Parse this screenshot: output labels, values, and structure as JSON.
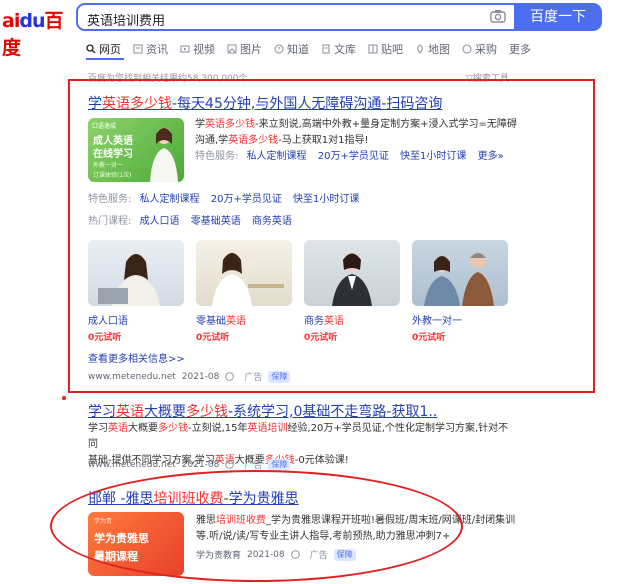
{
  "header": {
    "logo_prefix": "ai",
    "logo_du": "du",
    "logo_suffix": "百度",
    "search_value": "英语培训费用",
    "search_button": "百度一下"
  },
  "tabs": [
    {
      "label": "网页",
      "icon": "search-icon"
    },
    {
      "label": "资讯",
      "icon": "news-icon"
    },
    {
      "label": "视频",
      "icon": "video-icon"
    },
    {
      "label": "图片",
      "icon": "image-icon"
    },
    {
      "label": "知道",
      "icon": "question-icon"
    },
    {
      "label": "文库",
      "icon": "document-icon"
    },
    {
      "label": "贴吧",
      "icon": "forum-icon"
    },
    {
      "label": "地图",
      "icon": "map-icon"
    },
    {
      "label": "采购",
      "icon": "purchase-icon"
    },
    {
      "label": "更多",
      "icon": ""
    }
  ],
  "result_count": "百度为您找到相关结果约58,300,000个",
  "tools": "▽搜索工具",
  "ad1": {
    "title_pre": "学",
    "title_hl": "英语多少钱",
    "title_post": "-每天45分钟,与外国人无障碍沟通-扫码咨询",
    "thumb_tag": "口语速成",
    "thumb_line1": "成人英语",
    "thumb_line2": "在线学习",
    "thumb_line3": "外教一对一",
    "thumb_line4": "订课体验(1次)",
    "abs1_pre": "学",
    "abs1_hl": "英语多少钱",
    "abs1_post": "-来立刻说,高端中外教+量身定制方案+浸入式学习=无障碍",
    "abs2_pre": "沟通,学",
    "abs2_hl": "英语多少钱",
    "abs2_post": "-马上获取1对1指导!",
    "feature_label": "特色服务:",
    "feature_items": [
      "私人定制课程",
      "20万+学员见证",
      "快至1小时订课",
      "更多»"
    ],
    "feature2_label": "特色服务:",
    "feature2_items": [
      "私人定制课程",
      "20万+学员见证",
      "快至1小时订课"
    ],
    "hot_label": "热门课程:",
    "hot_items": [
      "成人口语",
      "零基础英语",
      "商务英语"
    ],
    "cards": [
      {
        "cap": "成人口语",
        "cap_hl": "",
        "free": "0元试听"
      },
      {
        "cap": "零基础",
        "cap_hl": "英语",
        "free": "0元试听"
      },
      {
        "cap": "商务",
        "cap_hl": "英语",
        "free": "0元试听"
      },
      {
        "cap": "外教一对一",
        "cap_hl": "",
        "free": "0元试听"
      }
    ],
    "more": "查看更多相关信息>>",
    "url": "www.metenedu.net",
    "date": "2021-08",
    "ad": "广告",
    "guarantee": "保障"
  },
  "ad2": {
    "title_pre": "学习",
    "title_hl1": "英语",
    "title_mid": "大概要",
    "title_hl2": "多少钱",
    "title_post": "-系统学习,0基础不走弯路-获取1..",
    "abs1_pre": "学习",
    "abs1_hl1": "英语",
    "abs1_mid": "大概要",
    "abs1_hl2": "多少钱",
    "abs1_mid2": "-立刻说,15年",
    "abs1_hl3": "英语培训",
    "abs1_post": "经验,20万+学员见证,个性化定制学习方案,针对不同",
    "abs2_pre": "基础-提供不同学习方案,学习",
    "abs2_hl1": "英语",
    "abs2_mid": "大概要",
    "abs2_hl2": "多少钱",
    "abs2_post": "-0元体验课!",
    "url": "www.metenedu.net",
    "date": "2021-08",
    "ad": "广告",
    "guarantee": "保障"
  },
  "ad3": {
    "title_pre": "邯郸 -雅思",
    "title_hl": "培训班收费",
    "title_post": "-学为贵雅思",
    "thumb_tag": "学为贵",
    "thumb_line1": "学为贵雅思",
    "thumb_line2": "暑期课程",
    "abs1_pre": "雅思",
    "abs1_hl": "培训班收费",
    "abs1_post": "_学为贵雅思课程开班啦!暑假班/周末班/网课班/封闭集训",
    "abs2": "等.听/说/读/写专业主讲人指导,考前预热,助力雅思冲刺7+",
    "source": "学为贵教育",
    "date": "2021-08",
    "ad": "广告",
    "guarantee": "保障"
  },
  "colors": {
    "accent": "#4e6ef2",
    "link": "#2440b3",
    "highlight": "#f73131",
    "annotation": "#e02020"
  }
}
